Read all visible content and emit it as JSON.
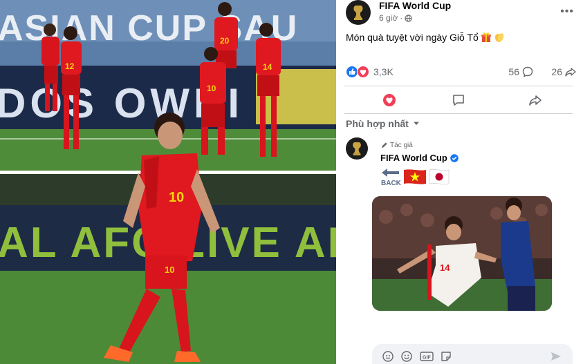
{
  "post": {
    "author": "FIFA World Cup",
    "time": "6 giờ",
    "privacy_icon": "globe-icon",
    "more_label": "•••",
    "caption": "Món quà tuyệt vời ngày Giỗ Tổ",
    "caption_emojis": [
      "gift-icon",
      "clapping-hands-icon"
    ]
  },
  "stats": {
    "reactions": "3,3K",
    "reaction_types": [
      "like",
      "love"
    ],
    "comments": "56",
    "shares": "26"
  },
  "actions": [
    "love-button",
    "comment-button",
    "share-button"
  ],
  "comments_sort": {
    "label": "Phù hợp nhất"
  },
  "top_comment": {
    "badge": "Tác giả",
    "author": "FIFA World Cup",
    "verified": true,
    "emojis": [
      "back-arrow-icon",
      "vietnam-flag",
      "japan-flag"
    ],
    "back_label": "BACK",
    "image_jersey": "14"
  },
  "composer": {
    "icons": [
      "avatar-sticker-icon",
      "emoji-icon",
      "gif-icon",
      "sticker-icon"
    ],
    "gif_label": "GIF"
  },
  "photo": {
    "banner_top": "ASIAN CUP SAU",
    "banner_mid": "DOS OWNI",
    "banner_bottom": "AL AFC LIVE AF",
    "jersey_main": "10",
    "jersey_numbers": [
      "12",
      "20",
      "14",
      "10"
    ]
  },
  "colors": {
    "accent": "#1877f2",
    "love": "#f33e58",
    "kit_red": "#d8141c",
    "kit_yellow": "#f6d30a",
    "pitch": "#4d8a38"
  }
}
